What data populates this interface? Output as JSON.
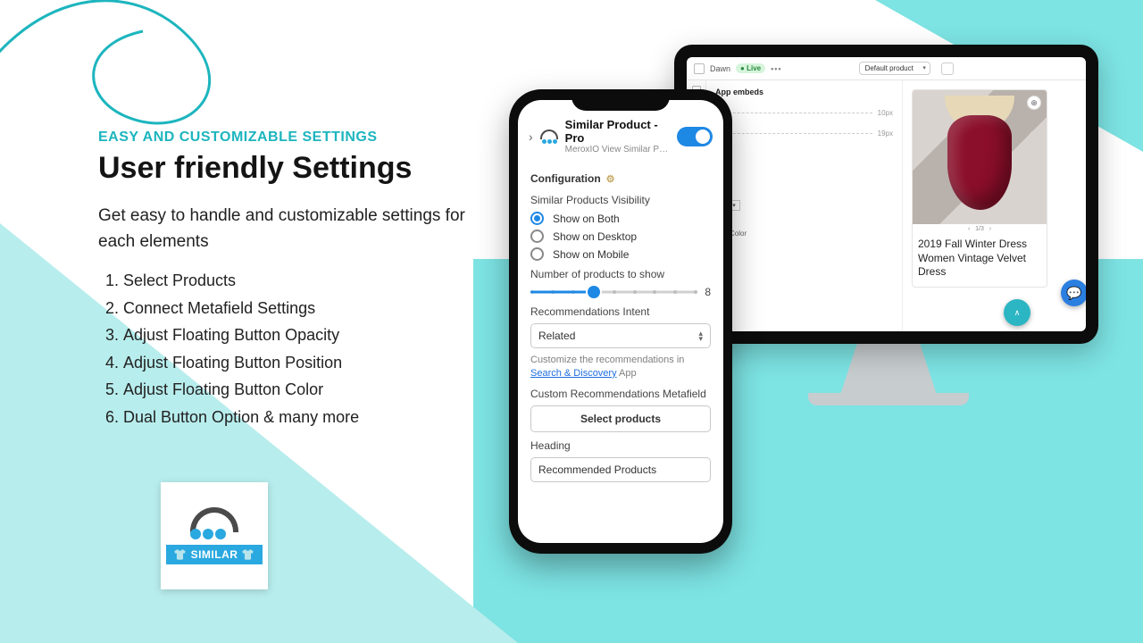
{
  "marketing": {
    "kicker": "EASY AND CUSTOMIZABLE SETTINGS",
    "headline": "User friendly Settings",
    "sub": "Get easy to handle and customizable settings for each elements",
    "items": [
      "Select Products",
      "Connect Metafield Settings",
      "Adjust Floating Button Opacity",
      "Adjust Floating Button Position",
      "Adjust Floating Button Color",
      "Dual Button Option & many more"
    ]
  },
  "logo": {
    "badge": "SIMILAR"
  },
  "phone": {
    "app_title": "Similar Product - Pro",
    "app_sub": "MeroxIO View Similar Prod...",
    "toggle_on": true,
    "section_title": "Configuration",
    "visibility_label": "Similar Products Visibility",
    "visibility_options": {
      "both": "Show on Both",
      "desktop": "Show on Desktop",
      "mobile": "Show on Mobile"
    },
    "visibility_selected": "both",
    "count_label": "Number of products to show",
    "count_value": "8",
    "intent_label": "Recommendations Intent",
    "intent_value": "Related",
    "hint_prefix": "Customize the recommendations in ",
    "hint_link": "Search & Discovery",
    "hint_suffix": " App",
    "metafield_label": "Custom Recommendations Metafield",
    "select_products_btn": "Select products",
    "heading_label": "Heading",
    "heading_value": "Recommended Products"
  },
  "monitor": {
    "theme": "Dawn",
    "live": "Live",
    "template_select": "Default product",
    "panel_title": "App embeds",
    "dim_a": "10px",
    "dim_b": "19px",
    "color_label": "Color",
    "product_title": "2019 Fall Winter Dress Women Vintage Velvet Dress",
    "pager": "1/3"
  }
}
